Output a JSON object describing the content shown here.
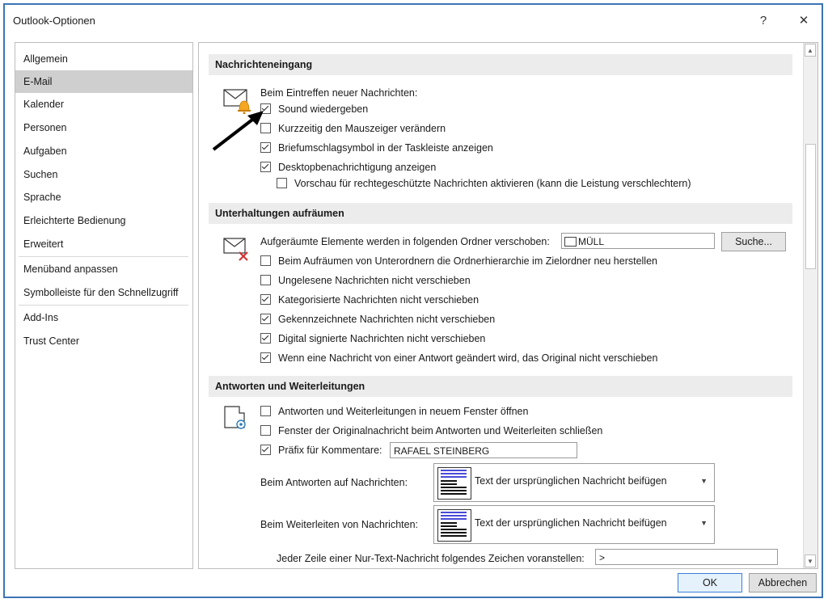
{
  "window": {
    "title": "Outlook-Optionen",
    "help_label": "?",
    "close_label": "✕"
  },
  "nav": {
    "items": [
      {
        "label": "Allgemein"
      },
      {
        "label": "E-Mail",
        "selected": true
      },
      {
        "label": "Kalender"
      },
      {
        "label": "Personen"
      },
      {
        "label": "Aufgaben"
      },
      {
        "label": "Suchen"
      },
      {
        "label": "Sprache"
      },
      {
        "label": "Erleichterte Bedienung"
      },
      {
        "label": "Erweitert"
      },
      {
        "label": "Menüband anpassen"
      },
      {
        "label": "Symbolleiste für den Schnellzugriff"
      },
      {
        "label": "Add-Ins"
      },
      {
        "label": "Trust Center"
      }
    ]
  },
  "sections": {
    "inbox": {
      "title": "Nachrichteneingang",
      "intro": "Beim Eintreffen neuer Nachrichten:",
      "opt1": "Sound wiedergeben",
      "opt2": "Kurzzeitig den Mauszeiger verändern",
      "opt3": "Briefumschlagsymbol in der Taskleiste anzeigen",
      "opt4": "Desktopbenachrichtigung anzeigen",
      "opt5": "Vorschau für rechtegeschützte Nachrichten aktivieren (kann die Leistung verschlechtern)"
    },
    "cleanup": {
      "title": "Unterhaltungen aufräumen",
      "folder_label": "Aufgeräumte Elemente werden in folgenden Ordner verschoben:",
      "folder_value": "MÜLL",
      "search_button": "Suche...",
      "opt1": "Beim Aufräumen von Unterordnern die Ordnerhierarchie im Zielordner neu herstellen",
      "opt2": "Ungelesene Nachrichten nicht verschieben",
      "opt3": "Kategorisierte Nachrichten nicht verschieben",
      "opt4": "Gekennzeichnete Nachrichten nicht verschieben",
      "opt5": "Digital signierte Nachrichten nicht verschieben",
      "opt6": "Wenn eine Nachricht von einer Antwort geändert wird, das Original nicht verschieben"
    },
    "replies": {
      "title": "Antworten und Weiterleitungen",
      "opt1": "Antworten und Weiterleitungen in neuem Fenster öffnen",
      "opt2": "Fenster der Originalnachricht beim Antworten und Weiterleiten schließen",
      "opt3": "Präfix für Kommentare:",
      "prefix_value": "RAFAEL STEINBERG",
      "reply_label": "Beim Antworten auf Nachrichten:",
      "reply_value": "Text der ursprünglichen Nachricht beifügen",
      "forward_label": "Beim Weiterleiten von Nachrichten:",
      "forward_value": "Text der ursprünglichen Nachricht beifügen",
      "plain_label": "Jeder Zeile einer Nur-Text-Nachricht folgendes Zeichen voranstellen:",
      "plain_value": ">"
    }
  },
  "footer": {
    "ok": "OK",
    "cancel": "Abbrechen"
  },
  "colors": {
    "accent": "#3c74b4",
    "bell": "#f5a623"
  }
}
